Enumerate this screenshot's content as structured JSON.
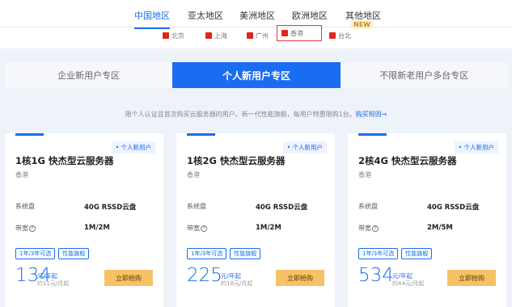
{
  "regions": [
    {
      "label": "中国地区",
      "active": true
    },
    {
      "label": "亚太地区",
      "active": false
    },
    {
      "label": "美洲地区",
      "active": false
    },
    {
      "label": "欧洲地区",
      "active": false
    },
    {
      "label": "其他地区",
      "active": false
    }
  ],
  "new_badge": "NEW",
  "cities": [
    {
      "label": "北京",
      "selected": false
    },
    {
      "label": "上海",
      "selected": false
    },
    {
      "label": "广州",
      "selected": false
    },
    {
      "label": "香港",
      "selected": true
    },
    {
      "label": "台北",
      "selected": false
    }
  ],
  "zones": [
    {
      "label": "企业新用户专区",
      "active": false
    },
    {
      "label": "个人新用户专区",
      "active": true
    },
    {
      "label": "不限新老用户多台专区",
      "active": false
    }
  ],
  "note": {
    "text": "限个人认证且首次购买云服务器的用户。新一代性能旗舰，每用户特惠限购1台。",
    "link": "购买规则→"
  },
  "cards": [
    {
      "tag": "• 个人新用户",
      "title": "1核1G 快杰型云服务器",
      "location": "香港",
      "disk_label": "系统盘",
      "disk_value": "40G RSSD云盘",
      "bw_label": "带宽",
      "bw_value": "1M/2M",
      "badges": [
        "1年/3年可选",
        "性能旗舰"
      ],
      "price": "134",
      "price_unit": "元/年起",
      "price_monthly": "约11元/月起",
      "buy_label": "立即抢购"
    },
    {
      "tag": "• 个人新用户",
      "title": "1核2G 快杰型云服务器",
      "location": "香港",
      "disk_label": "系统盘",
      "disk_value": "40G RSSD云盘",
      "bw_label": "带宽",
      "bw_value": "1M/2M",
      "badges": [
        "1年/3年可选",
        "性能旗舰"
      ],
      "price": "225",
      "price_unit": "元/年起",
      "price_monthly": "约18元/月起",
      "buy_label": "立即抢购"
    },
    {
      "tag": "• 个人新用户",
      "title": "2核4G 快杰型云服务器",
      "location": "香港",
      "disk_label": "系统盘",
      "disk_value": "40G RSSD云盘",
      "bw_label": "带宽",
      "bw_value": "2M/5M",
      "badges": [
        "1年/3年可选",
        "性能旗舰"
      ],
      "price": "534",
      "price_unit": "元/年起",
      "price_monthly": "约44元/月起",
      "buy_label": "立即抢购"
    }
  ],
  "help_icon_glyph": "?",
  "colors": {
    "accent": "#1a6cf0",
    "buy": "#f7c266",
    "highlight_border": "#e53935"
  }
}
